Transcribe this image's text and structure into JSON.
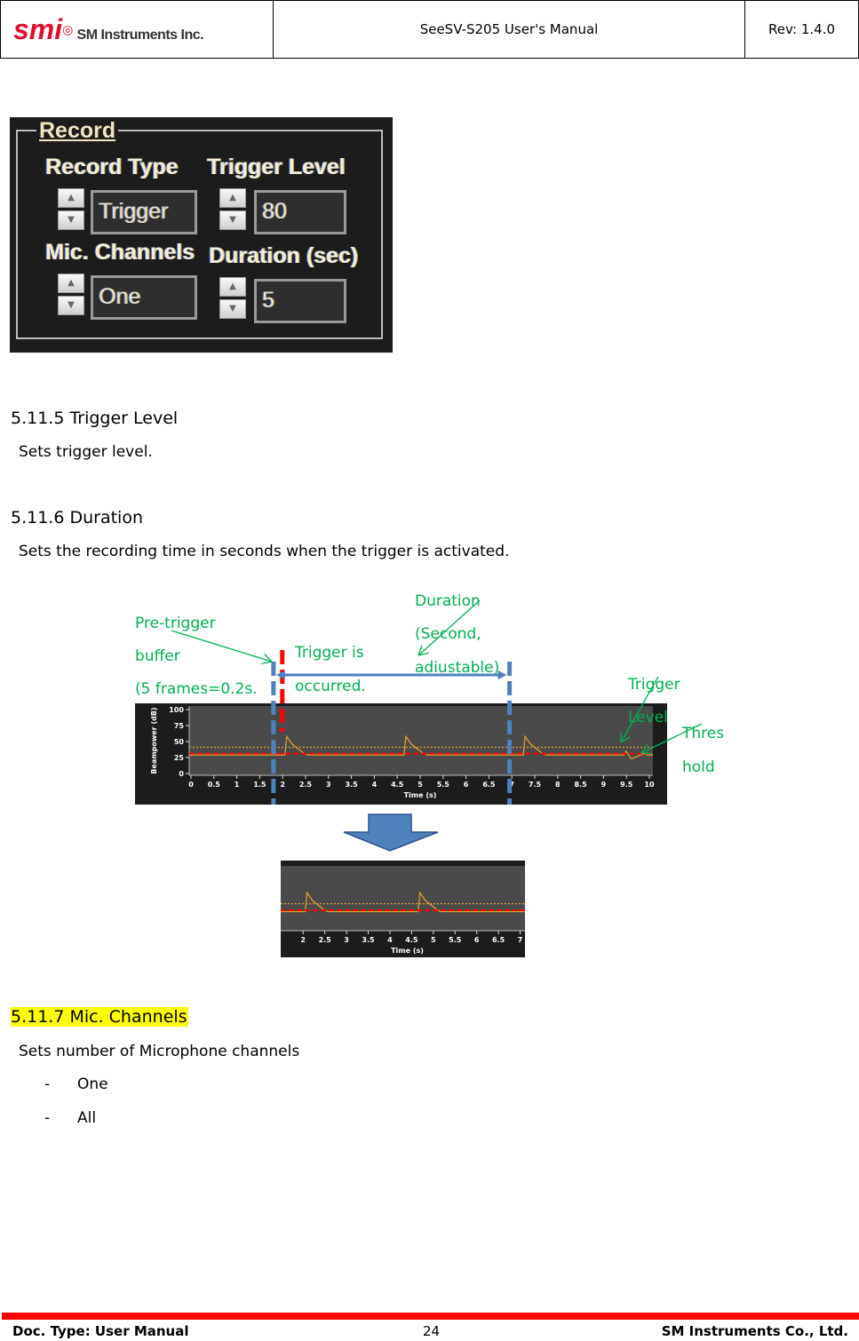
{
  "header": {
    "company_logo": "SM Instruments Inc.",
    "logo_mark": "smi",
    "title": "SeeSV-S205 User's Manual",
    "revision": "Rev: 1.4.0"
  },
  "record_panel": {
    "title": "Record",
    "record_type": {
      "label": "Record Type",
      "value": "Trigger"
    },
    "trigger_level": {
      "label": "Trigger Level",
      "value": "80"
    },
    "mic_channels": {
      "label": "Mic. Channels",
      "value": "One"
    },
    "duration": {
      "label": "Duration (sec)",
      "value": "5"
    }
  },
  "sections": [
    {
      "heading": "5.11.5 Trigger Level",
      "body": "Sets trigger level."
    },
    {
      "heading": "5.11.6 Duration",
      "body": "Sets the recording time in seconds when the trigger is activated."
    },
    {
      "heading": "5.11.7 Mic. Channels",
      "body": "Sets number of Microphone channels",
      "highlight": "#ffff00",
      "items": [
        "One",
        "All"
      ],
      "bullet": "-"
    }
  ],
  "annotations": {
    "pretrigger": [
      "Pre-trigger",
      "buffer",
      "(5 frames=0.2s."
    ],
    "trigger": [
      "Trigger is",
      "occurred."
    ],
    "duration": [
      "Duration",
      "(Second,",
      "adiustable)"
    ],
    "trigger_level": [
      "Trigger",
      "Level"
    ],
    "threshold": [
      "Thres",
      "hold"
    ],
    "color": "#00b050"
  },
  "chart_data": [
    {
      "type": "line",
      "ylabel": "Beampower (dB)",
      "xlabel": "Time (s)",
      "xlim": [
        0,
        10
      ],
      "ylim": [
        0,
        100
      ],
      "xticks": [
        "0",
        "0.5",
        "1",
        "1.5",
        "2",
        "2.5",
        "3",
        "3.5",
        "4",
        "4.5",
        "5",
        "5.5",
        "6",
        "6.5",
        "7",
        "7.5",
        "8",
        "8.5",
        "9",
        "9.5",
        "10"
      ],
      "yticks": [
        "100",
        "75",
        "50",
        "25",
        "0"
      ],
      "trigger_level": 41,
      "threshold": 31,
      "baseline": 29,
      "peaks": [
        {
          "t": 2.05,
          "db": 58
        },
        {
          "t": 4.65,
          "db": 58
        },
        {
          "t": 7.25,
          "db": 58
        },
        {
          "t": 9.45,
          "db": 35
        }
      ],
      "pretrigger_marker": 1.8,
      "trigger_marker": 2.05,
      "end_marker": 6.95,
      "colors": {
        "signal": "#f0a030",
        "threshold": "#ff0000",
        "trigger_level": "#f0a030",
        "marker": "#4f81bd",
        "trigger": "#ff0000"
      }
    },
    {
      "type": "line",
      "xlabel": "Time (s)",
      "xlim": [
        1.75,
        7.05
      ],
      "ylim": [
        0,
        100
      ],
      "xticks": [
        "2",
        "2.5",
        "3",
        "3.5",
        "4",
        "4.5",
        "5",
        "5.5",
        "6",
        "6.5",
        "7"
      ],
      "trigger_level": 41,
      "threshold": 31,
      "baseline": 29,
      "peaks": [
        {
          "t": 2.05,
          "db": 58
        },
        {
          "t": 4.65,
          "db": 58
        }
      ]
    }
  ],
  "footer": {
    "doc_type": "Doc. Type: User Manual",
    "page": "24",
    "company": "SM Instruments Co., Ltd.",
    "rule_color": "#ff0000"
  }
}
